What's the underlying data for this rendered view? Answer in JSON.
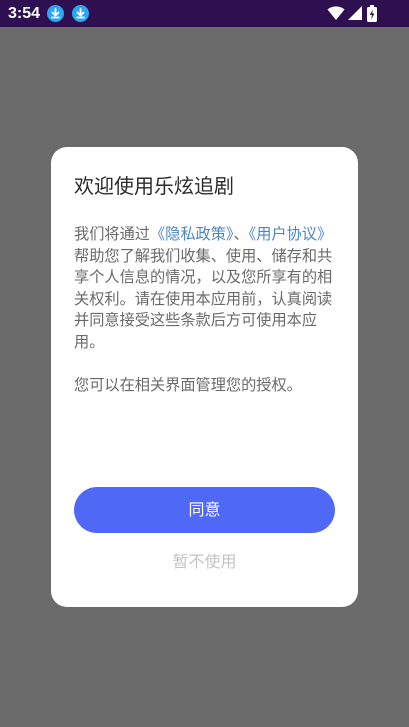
{
  "status_bar": {
    "time": "3:54",
    "icons": [
      "download-icon",
      "download-icon",
      "wifi-icon",
      "signal-icon",
      "battery-charging-icon"
    ]
  },
  "colors": {
    "status_bar_bg": "#2e0f50",
    "scrim": "#6b6b6b",
    "accent": "#5068f6",
    "link": "#4a86c8",
    "download_badge": "#2aa6f5"
  },
  "dialog": {
    "title": "欢迎使用乐炫追剧",
    "body": {
      "text_before": "我们将通过",
      "privacy_link": "《隐私政策》",
      "separator": "、",
      "terms_link": "《用户协议》",
      "text_after": "帮助您了解我们收集、使用、储存和共享个人信息的情况，以及您所享有的相关权利。请在使用本应用前，认真阅读并同意接受这些条款后方可使用本应用。",
      "paragraph2": "您可以在相关界面管理您的授权。"
    },
    "agree_label": "同意",
    "decline_label": "暂不使用"
  }
}
